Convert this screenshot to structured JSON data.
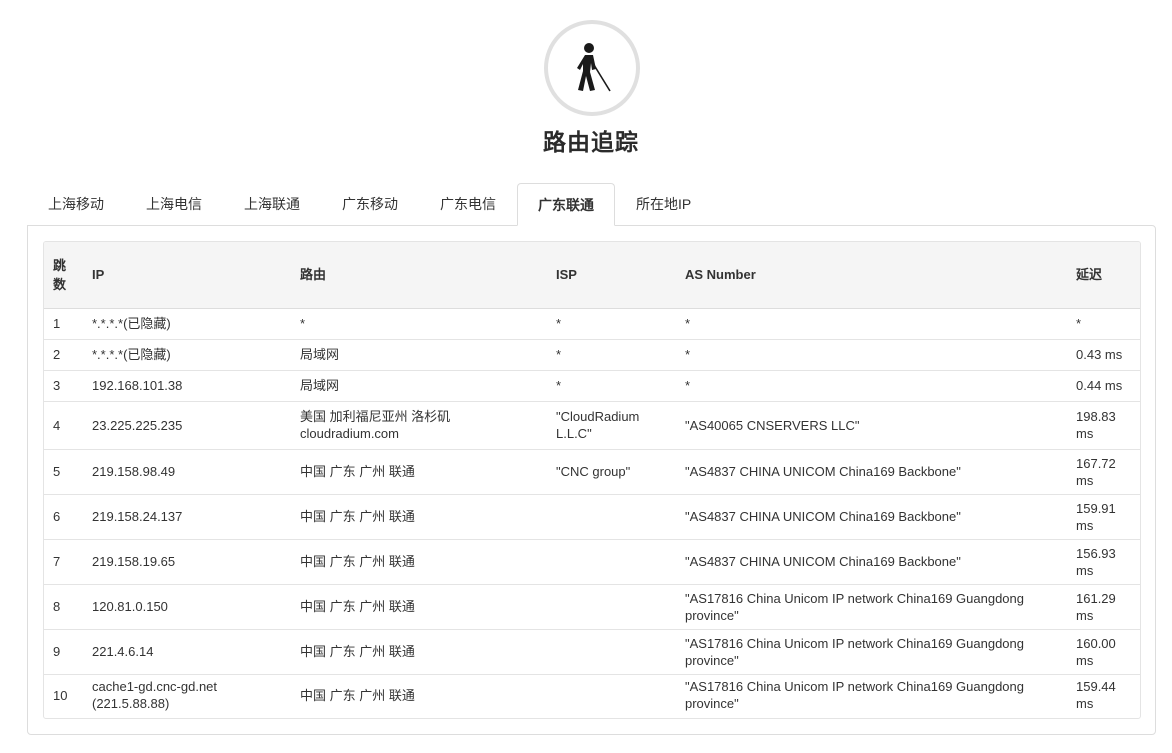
{
  "page": {
    "title": "路由追踪",
    "logo_icon": "person-walking-with-cane-icon"
  },
  "tabs": [
    {
      "label": "上海移动",
      "active": false
    },
    {
      "label": "上海电信",
      "active": false
    },
    {
      "label": "上海联通",
      "active": false
    },
    {
      "label": "广东移动",
      "active": false
    },
    {
      "label": "广东电信",
      "active": false
    },
    {
      "label": "广东联通",
      "active": true
    },
    {
      "label": "所在地IP",
      "active": false
    }
  ],
  "table": {
    "headers": {
      "hop": "跳数",
      "ip": "IP",
      "route": "路由",
      "isp": "ISP",
      "asn": "AS Number",
      "latency": "延迟"
    },
    "rows": [
      {
        "hop": "1",
        "ip": "*.*.*.*(已隐藏)",
        "route": "*",
        "isp": "*",
        "asn": "*",
        "latency": "*"
      },
      {
        "hop": "2",
        "ip": "*.*.*.*(已隐藏)",
        "route": "局域网",
        "isp": "*",
        "asn": "*",
        "latency": "0.43 ms"
      },
      {
        "hop": "3",
        "ip": "192.168.101.38",
        "route": "局域网",
        "isp": "*",
        "asn": "*",
        "latency": "0.44 ms"
      },
      {
        "hop": "4",
        "ip": "23.225.225.235",
        "route": "美国 加利福尼亚州 洛杉矶 cloudradium.com",
        "isp": "\"CloudRadium L.L.C\"",
        "asn": "\"AS40065 CNSERVERS LLC\"",
        "latency": "198.83 ms"
      },
      {
        "hop": "5",
        "ip": "219.158.98.49",
        "route": "中国 广东 广州 联通",
        "isp": "\"CNC group\"",
        "asn": "\"AS4837 CHINA UNICOM China169 Backbone\"",
        "latency": "167.72 ms"
      },
      {
        "hop": "6",
        "ip": "219.158.24.137",
        "route": "中国 广东 广州 联通",
        "isp": "",
        "asn": "\"AS4837 CHINA UNICOM China169 Backbone\"",
        "latency": "159.91 ms"
      },
      {
        "hop": "7",
        "ip": "219.158.19.65",
        "route": "中国 广东 广州 联通",
        "isp": "",
        "asn": "\"AS4837 CHINA UNICOM China169 Backbone\"",
        "latency": "156.93 ms"
      },
      {
        "hop": "8",
        "ip": "120.81.0.150",
        "route": "中国 广东 广州 联通",
        "isp": "",
        "asn": "\"AS17816 China Unicom IP network China169 Guangdong province\"",
        "latency": "161.29 ms"
      },
      {
        "hop": "9",
        "ip": "221.4.6.14",
        "route": "中国 广东 广州 联通",
        "isp": "",
        "asn": "\"AS17816 China Unicom IP network China169 Guangdong province\"",
        "latency": "160.00 ms"
      },
      {
        "hop": "10",
        "ip": "cache1-gd.cnc-gd.net (221.5.88.88)",
        "route": "中国 广东 广州 联通",
        "isp": "",
        "asn": "\"AS17816 China Unicom IP network China169 Guangdong province\"",
        "latency": "159.44 ms"
      }
    ]
  }
}
